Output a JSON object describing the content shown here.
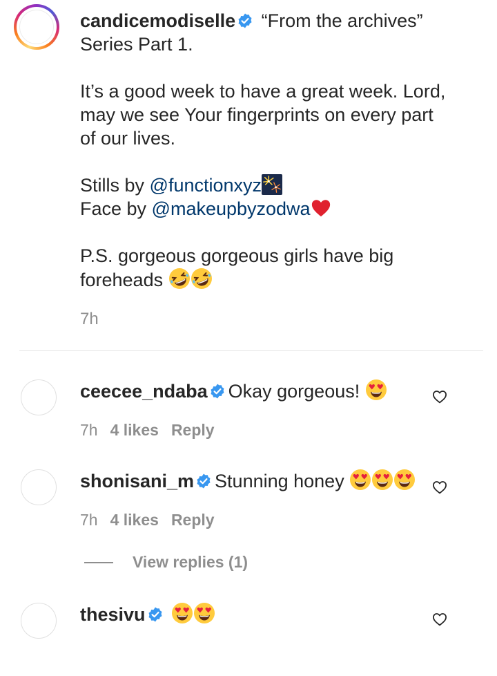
{
  "post": {
    "author": "candicemodiselle",
    "caption_head": " “From the archives”",
    "caption_line2": "Series Part 1.",
    "para1": "It’s a good week to have a great week. Lord, may we see Your fingerprints on every part of our lives.",
    "stills_prefix": "Stills by ",
    "stills_mention": "@functionxyz",
    "stills_emoji": "fireworks",
    "face_prefix": "Face by ",
    "face_mention": "@makeupbyzodwa",
    "face_emoji": "red-heart",
    "ps_text": "P.S. gorgeous gorgeous girls have big foreheads ",
    "ps_emoji": "rolling-on-floor-laughing x2",
    "time": "7h"
  },
  "comments": [
    {
      "username": "ceecee_ndaba",
      "text": "Okay gorgeous! ",
      "emoji": "heart-eyes x1",
      "time": "7h",
      "likes": "4 likes",
      "reply": "Reply"
    },
    {
      "username": "shonisani_m",
      "text": "Stunning honey ",
      "emoji": "heart-eyes x3",
      "time": "7h",
      "likes": "4 likes",
      "reply": "Reply"
    },
    {
      "username": "thesivu",
      "text": " ",
      "emoji": "heart-eyes x2"
    }
  ],
  "view_replies": "View replies (1)",
  "colors": {
    "text": "#262626",
    "secondary": "#8e8e8e",
    "mention": "#00376b",
    "verified": "#3897f0",
    "divider": "#e6e6e6"
  },
  "icons": [
    "verified-badge-icon",
    "heart-outline-icon",
    "heart-eyes-emoji",
    "rofl-emoji",
    "fireworks-emoji",
    "red-heart-emoji"
  ]
}
